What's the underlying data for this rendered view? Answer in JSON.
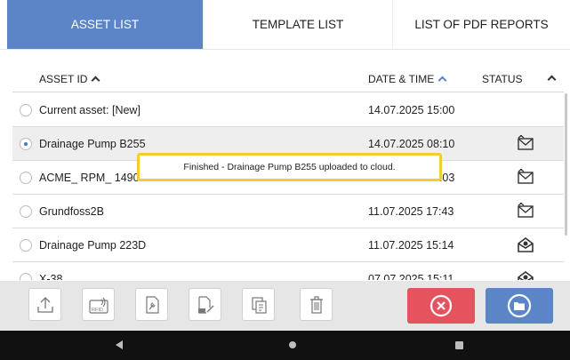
{
  "tabs": [
    {
      "label": "ASSET LIST",
      "active": true
    },
    {
      "label": "TEMPLATE LIST",
      "active": false
    },
    {
      "label": "LIST OF PDF REPORTS",
      "active": false
    }
  ],
  "table": {
    "headers": {
      "asset_id": "ASSET ID",
      "date_time": "DATE & TIME",
      "status": "STATUS"
    },
    "rows": [
      {
        "name": "Current asset: [New]",
        "date": "14.07.2025 15:00",
        "status_icon": "",
        "selected": false
      },
      {
        "name": "Drainage Pump B255",
        "date": "14.07.2025 08:10",
        "status_icon": "mail-sent-icon",
        "selected": true
      },
      {
        "name": "ACME_ RPM_ 1490",
        "date": "14.07.2025 08:03",
        "status_icon": "mail-sent-icon",
        "selected": false
      },
      {
        "name": "Grundfoss2B",
        "date": "11.07.2025 17:43",
        "status_icon": "mail-sent-icon",
        "selected": false
      },
      {
        "name": "Drainage Pump 223D",
        "date": "11.07.2025 15:14",
        "status_icon": "mail-open-icon",
        "selected": false
      },
      {
        "name": "X-38",
        "date": "07.07.2025 15:11",
        "status_icon": "mail-open-icon",
        "selected": false
      }
    ]
  },
  "toast": {
    "text": "Finished - Drainage Pump B255 uploaded to cloud."
  },
  "toolbar": {
    "buttons": [
      "upload-icon",
      "rfid-icon",
      "wrench-doc-icon",
      "sign-doc-icon",
      "copy-doc-icon",
      "trash-icon"
    ],
    "rfid_label": "RFID",
    "cancel_color": "#e5535e",
    "open_color": "#5b85c6"
  },
  "colors": {
    "accent": "#5b85c6",
    "toast_border": "#f2cd2e",
    "selected_row": "#eeeeee"
  }
}
